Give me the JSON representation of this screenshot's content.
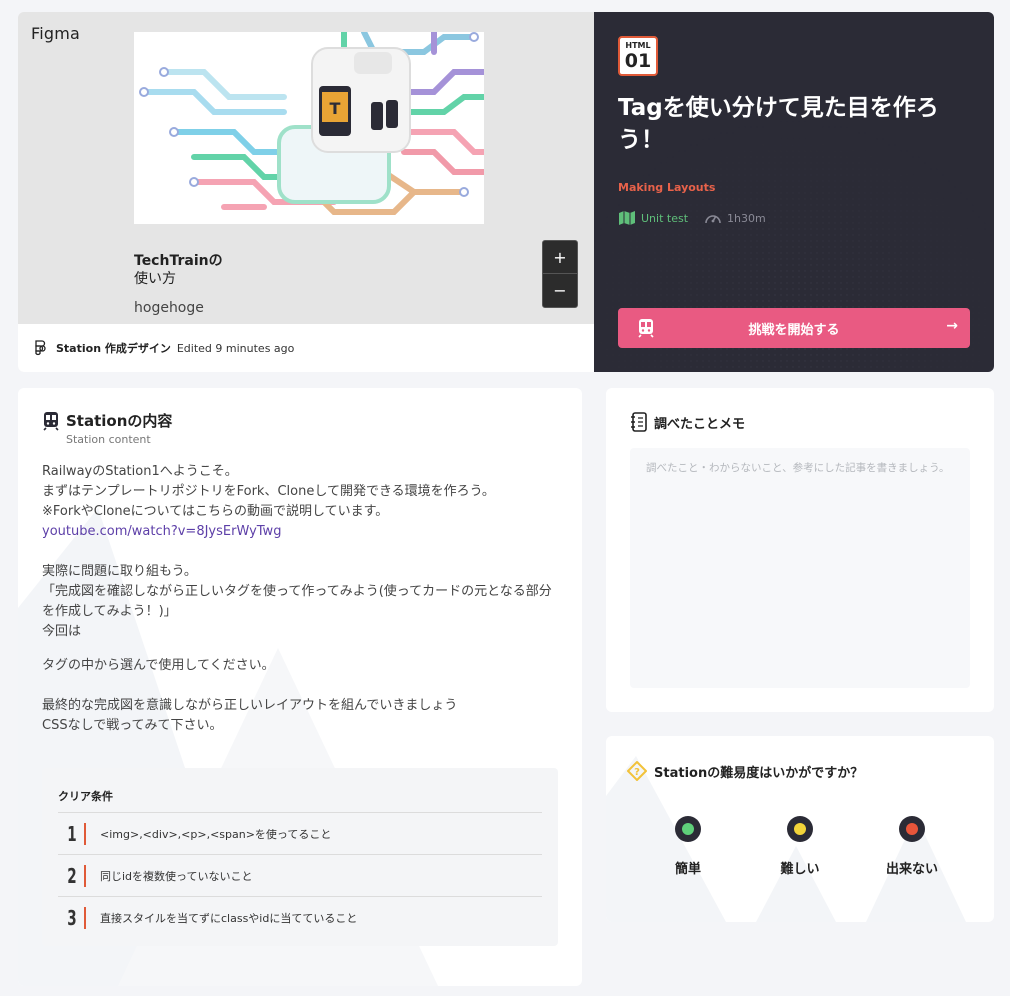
{
  "figma": {
    "logo": "Figma",
    "card_title_line1": "TechTrainの",
    "card_title_line2": "使い方",
    "card_subtitle": "hogehoge",
    "zoom_in": "+",
    "zoom_out": "−",
    "file_name": "Station 作成デザイン",
    "edited": "Edited 9 minutes ago"
  },
  "station": {
    "badge_top": "HTML",
    "badge_num": "01",
    "title": "Tagを使い分けて見た目を作ろう！",
    "category": "Making Layouts",
    "unit_test": "Unit test",
    "duration": "1h30m",
    "start_button": "挑戦を開始する",
    "accent": "#e95a82"
  },
  "content": {
    "title": "Stationの内容",
    "subtitle": "Station content",
    "para1": "RailwayのStation1へようこそ。\nまずはテンプレートリポジトリをFork、Cloneして開発できる環境を作ろう。\n※ForkやCloneについてはこちらの動画で説明しています。",
    "link": "youtube.com/watch?v=8JysErWyTwg",
    "para2": "実際に問題に取り組もう。\n「完成図を確認しながら正しいタグを使って作ってみよう(使ってカードの元となる部分を作成してみよう！)」\n今回は",
    "para3": "タグの中から選んで使用してください。",
    "para4": "最終的な完成図を意識しながら正しいレイアウトを組んでいきましょう\nCSSなしで戦ってみて下さい。",
    "clear_title": "クリア条件",
    "conditions": [
      {
        "num": "1",
        "text": "<img>,<div>,<p>,<span>を使ってること"
      },
      {
        "num": "2",
        "text": "同じidを複数使っていないこと"
      },
      {
        "num": "3",
        "text": "直接スタイルを当てずにclassやidに当てていること"
      }
    ]
  },
  "memo": {
    "title": "調べたことメモ",
    "placeholder": "調べたこと・わからないこと、参考にした記事を書きましょう。",
    "value": ""
  },
  "difficulty": {
    "title": "Stationの難易度はいかがですか？",
    "options": [
      {
        "label": "簡単",
        "color": "#5fcf7a"
      },
      {
        "label": "難しい",
        "color": "#f2d43a"
      },
      {
        "label": "出来ない",
        "color": "#e8553a"
      }
    ]
  }
}
